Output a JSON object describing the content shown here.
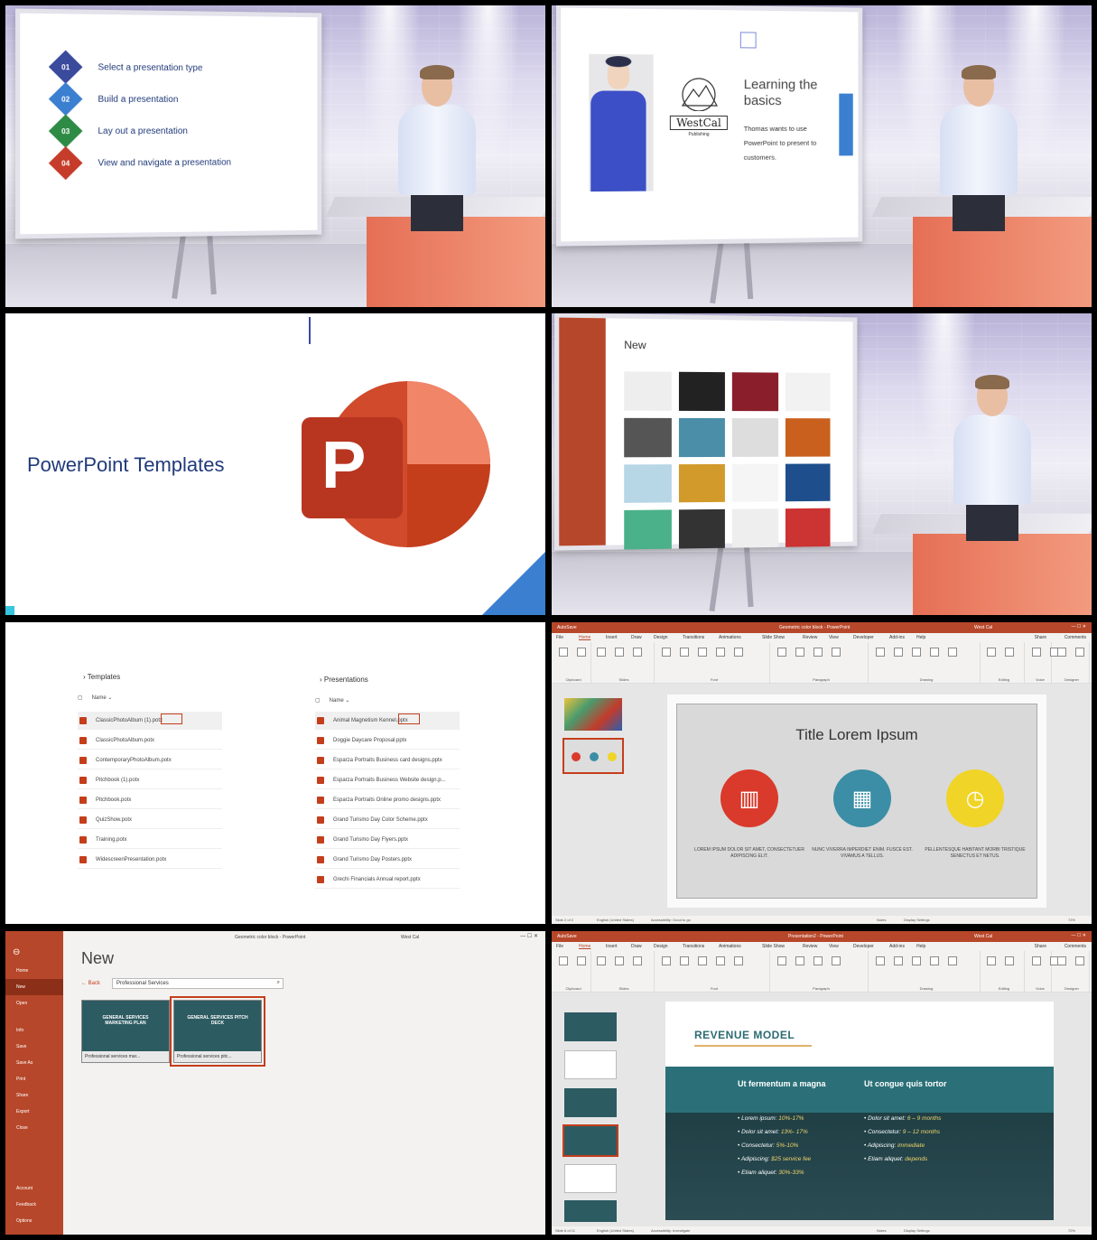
{
  "slide1": {
    "items": [
      {
        "num": "01",
        "label": "Select a presentation type",
        "color": "#3a4a9c"
      },
      {
        "num": "02",
        "label": "Build a presentation",
        "color": "#3b7fd1"
      },
      {
        "num": "03",
        "label": "Lay out a presentation",
        "color": "#2e8b46"
      },
      {
        "num": "04",
        "label": "View and navigate a presentation",
        "color": "#c63c2a"
      }
    ]
  },
  "slide2": {
    "logo_text": "WestCal",
    "logo_sub": "Publishing",
    "title": "Learning the basics",
    "body": "Thomas wants to use PowerPoint to present to customers."
  },
  "slide3": {
    "title": "PowerPoint Templates",
    "logo_letter": "P"
  },
  "slide4": {
    "heading": "New"
  },
  "slide5": {
    "templates": {
      "breadcrumb": "Templates",
      "col": "Name",
      "files": [
        "ClassicPhotoAlbum (1).potx",
        "ClassicPhotoAlbum.potx",
        "ContemporaryPhotoAlbum.potx",
        "Pitchbook (1).potx",
        "Pitchbook.potx",
        "QuizShow.potx",
        "Training.potx",
        "WidescreenPresentation.potx"
      ]
    },
    "presentations": {
      "breadcrumb": "Presentations",
      "col": "Name",
      "files": [
        "Animal Magnetism Kennel.pptx",
        "Doggie Daycare Proposal.pptx",
        "Esparza Portraits Business card designs.pptx",
        "Esparza Portraits Business Website design.p...",
        "Esparza Portraits Online promo designs.pptx",
        "Grand Turismo Day Color Scheme.pptx",
        "Grand Turismo Day Flyers.pptx",
        "Grand Turismo Day Posters.pptx",
        "Grechi Financials Annual report.pptx"
      ]
    }
  },
  "slide6": {
    "titlebar": "Geometric color block - PowerPoint",
    "autosave": "AutoSave",
    "user": "West Cal",
    "tabs": [
      "File",
      "Home",
      "Insert",
      "Draw",
      "Design",
      "Transitions",
      "Animations",
      "Slide Show",
      "Review",
      "View",
      "Developer",
      "Add-ins",
      "Help"
    ],
    "share": "Share",
    "comments": "Comments",
    "groups": [
      "Clipboard",
      "Slides",
      "Font",
      "Paragraph",
      "Drawing",
      "Editing",
      "Voice",
      "Designer"
    ],
    "slide_title": "Title Lorem Ipsum",
    "captions": [
      "LOREM IPSUM DOLOR SIT AMET, CONSECTETUER ADIPISCING ELIT.",
      "NUNC VIVERRA IMPERDIET ENIM. FUSCE EST. VIVAMUS A TELLUS.",
      "PELLENTESQUE HABITANT MORBI TRISTIQUE SENECTUS ET NETUS."
    ],
    "circle_colors": [
      "#d93a2b",
      "#3b8ea5",
      "#f0d427"
    ],
    "status_left": "Slide 2 of 2",
    "status_lang": "English (United States)",
    "status_access": "Accessibility: Good to go",
    "status_notes": "Notes",
    "status_display": "Display Settings",
    "zoom": "72%"
  },
  "slide7": {
    "titlebar": "Geometric color block - PowerPoint",
    "user": "West Cal",
    "heading": "New",
    "back": "Back",
    "search": "Professional Services",
    "sidebar": [
      "Home",
      "New",
      "Open",
      "Info",
      "Save",
      "Save As",
      "Print",
      "Share",
      "Export",
      "Close"
    ],
    "sidebar_bottom": [
      "Account",
      "Feedback",
      "Options"
    ],
    "cards": [
      {
        "title": "GENERAL SERVICES MARKETING PLAN",
        "label": "Professional services mar..."
      },
      {
        "title": "GENERAL SERVICES PITCH DECK",
        "label": "Professional services pitc..."
      }
    ]
  },
  "slide8": {
    "titlebar": "Presentation2 - PowerPoint",
    "heading": "REVENUE MODEL",
    "col1_title": "Ut fermentum a magna",
    "col2_title": "Ut congue quis tortor",
    "col1": [
      {
        "k": "Lorem ipsum:",
        "v": "10%-17%"
      },
      {
        "k": "Dolor sit amet:",
        "v": "13%- 17%"
      },
      {
        "k": "Consectetur:",
        "v": "5%-10%"
      },
      {
        "k": "Adipiscing:",
        "v": "$25 service fee"
      },
      {
        "k": "Etiam aliquet:",
        "v": "30%-33%"
      }
    ],
    "col2": [
      {
        "k": "Dolor sit amet:",
        "v": "6 – 9 months"
      },
      {
        "k": "Consectetur:",
        "v": "9 – 12 months"
      },
      {
        "k": "Adipiscing:",
        "v": "immediate"
      },
      {
        "k": "Etiam aliquet:",
        "v": "depends"
      }
    ],
    "status_left": "Slide 6 of 11",
    "status_lang": "English (United States)",
    "status_access": "Accessibility: Investigate"
  }
}
